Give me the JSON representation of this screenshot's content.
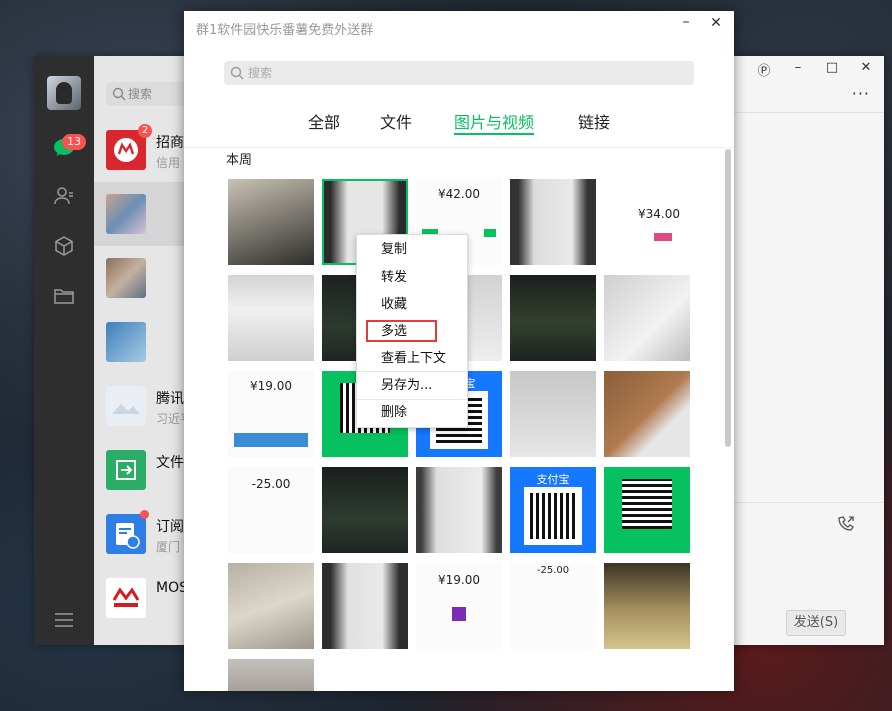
{
  "main_window": {
    "nav": {
      "chat_badge": "13",
      "icons": [
        "chat-icon",
        "contacts-icon",
        "collection-icon",
        "folder-icon",
        "menu-icon"
      ]
    },
    "search_placeholder": "搜索",
    "chats": [
      {
        "title": "招商",
        "subtitle": "信用",
        "badge": "2"
      },
      {
        "title": "",
        "subtitle": ""
      },
      {
        "title": "",
        "subtitle": ""
      },
      {
        "title": "",
        "subtitle": ""
      },
      {
        "title": "腾讯",
        "subtitle": "习近平"
      },
      {
        "title": "文件",
        "subtitle": ""
      },
      {
        "title": "订阅",
        "subtitle": "厦门"
      },
      {
        "title": "MOS",
        "subtitle": ""
      }
    ],
    "window_controls": {
      "pin": "Ⓟ",
      "minimize": "–",
      "maximize": "□",
      "close": "✕"
    },
    "more": "···",
    "send_button": "发送(S)"
  },
  "dialog": {
    "title": "群1软件园快乐番薯免费外送群",
    "minimize": "–",
    "close": "✕",
    "search_placeholder": "搜索",
    "tabs": [
      "全部",
      "文件",
      "图片与视频",
      "链接"
    ],
    "active_tab": "图片与视频",
    "section_label": "本周",
    "thumb_texts": {
      "t1_3": "¥42.00",
      "t1_5": "¥34.00",
      "t3_1": "¥19.00",
      "t4_1": "-25.00",
      "t4_4": "支付宝",
      "t3_2": "支付宝",
      "t5_3": "¥19.00",
      "t5_4": "-25.00"
    },
    "context_menu": [
      "复制",
      "转发",
      "收藏",
      "多选",
      "查看上下文",
      "另存为...",
      "删除"
    ],
    "highlighted_item": "多选"
  },
  "colors": {
    "accent_green": "#07c160",
    "badge_red": "#fa5151",
    "highlight_red": "#e23b3b",
    "alipay_blue": "#1677ff"
  }
}
